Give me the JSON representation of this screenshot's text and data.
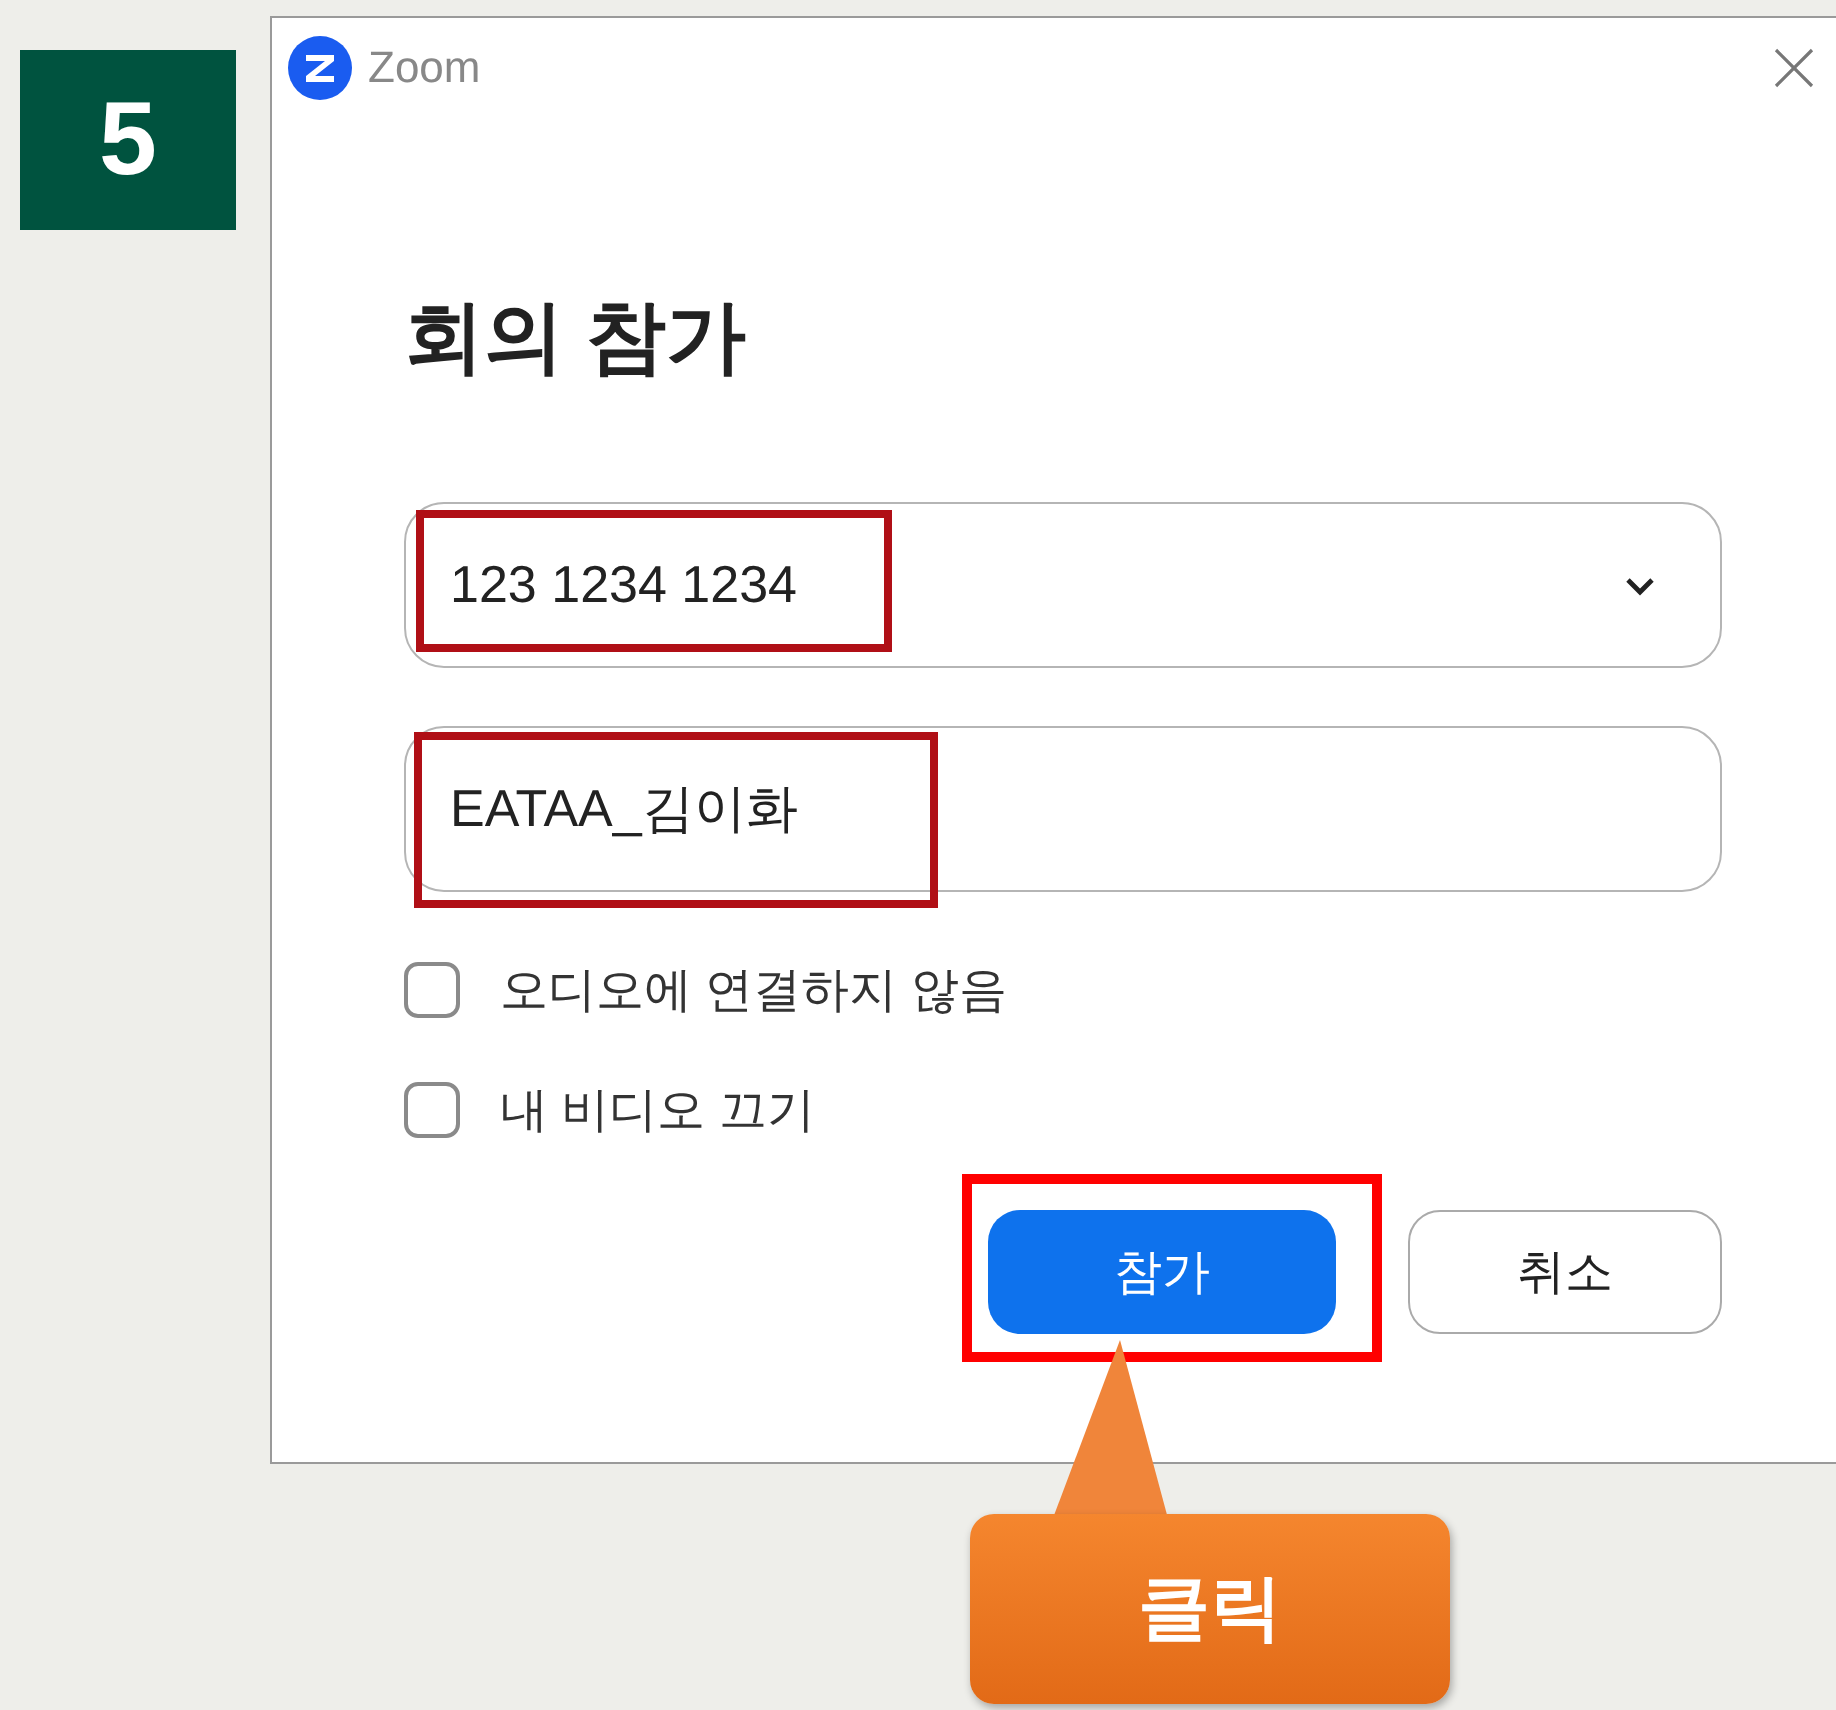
{
  "step": "5",
  "window": {
    "title": "Zoom"
  },
  "heading": "회의 참가",
  "meeting_id": {
    "value": "123 1234 1234"
  },
  "name_field": {
    "value": "EATAA_김이화"
  },
  "options": [
    {
      "label": "오디오에 연결하지 않음",
      "checked": false
    },
    {
      "label": "내 비디오 끄기",
      "checked": false
    }
  ],
  "buttons": [
    {
      "label": "참가",
      "kind": "primary"
    },
    {
      "label": "취소",
      "kind": "secondary"
    }
  ],
  "callout": {
    "text": "클릭"
  }
}
